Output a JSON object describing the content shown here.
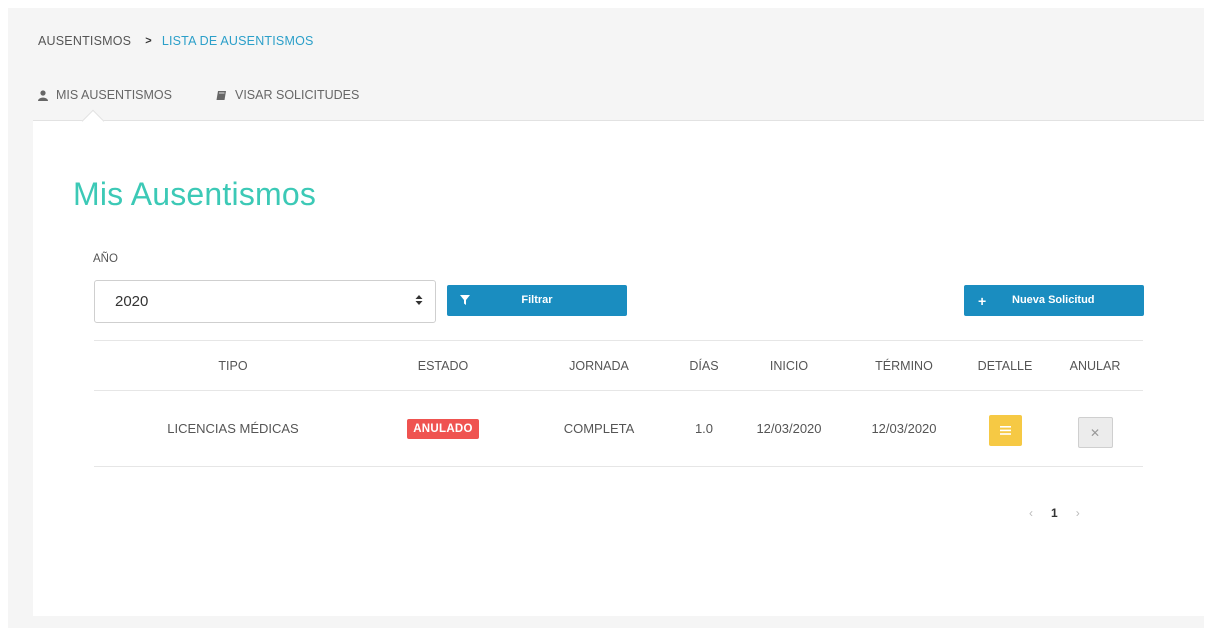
{
  "breadcrumb": {
    "root": "AUSENTISMOS",
    "current": "LISTA DE AUSENTISMOS"
  },
  "tabs": [
    {
      "label": "MIS AUSENTISMOS",
      "icon": "user-icon",
      "active": true
    },
    {
      "label": "VISAR SOLICITUDES",
      "icon": "book-icon",
      "active": false
    }
  ],
  "page": {
    "title": "Mis Ausentismos"
  },
  "filter": {
    "year_label": "AÑO",
    "year_value": "2020",
    "filter_button": "Filtrar",
    "new_button": "Nueva Solicitud"
  },
  "table": {
    "columns": [
      "TIPO",
      "ESTADO",
      "JORNADA",
      "DÍAS",
      "INICIO",
      "TÉRMINO",
      "DETALLE",
      "ANULAR"
    ],
    "rows": [
      {
        "tipo": "LICENCIAS MÉDICAS",
        "estado": "ANULADO",
        "jornada": "COMPLETA",
        "dias": "1.0",
        "inicio": "12/03/2020",
        "termino": "12/03/2020"
      }
    ]
  },
  "pagination": {
    "current": "1",
    "prev": "‹",
    "next": "›"
  },
  "colors": {
    "accent_title": "#3cc9b6",
    "primary_button": "#1a8dc0",
    "badge_danger": "#ef5350",
    "detail_button": "#f6c944",
    "link": "#2b9fc9"
  }
}
